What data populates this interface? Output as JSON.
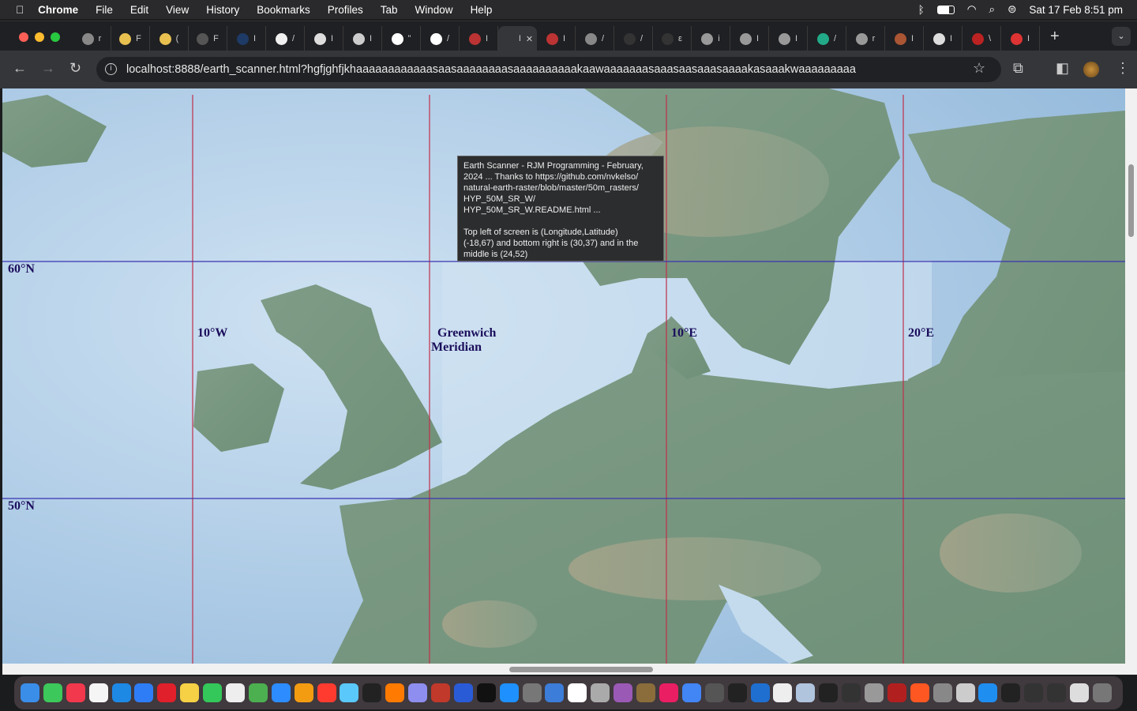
{
  "menubar": {
    "apple": "",
    "app": "Chrome",
    "items": [
      "File",
      "Edit",
      "View",
      "History",
      "Bookmarks",
      "Profiles",
      "Tab",
      "Window",
      "Help"
    ],
    "clock": "Sat 17 Feb  8:51 pm",
    "status_icons": [
      "bluetooth-icon",
      "battery-icon",
      "wifi-icon",
      "search-icon",
      "control-center-icon"
    ]
  },
  "tabs": [
    {
      "t": "r",
      "c": "#888"
    },
    {
      "t": "F",
      "c": "#e8c050"
    },
    {
      "t": "(",
      "c": "#e8c050"
    },
    {
      "t": "F",
      "c": "#555"
    },
    {
      "t": "I",
      "c": "#1e3a66"
    },
    {
      "t": "/",
      "c": "#f0f0f0"
    },
    {
      "t": "I",
      "c": "#ddd"
    },
    {
      "t": "I",
      "c": "#ccc"
    },
    {
      "t": "\"",
      "c": "#fff"
    },
    {
      "t": "/",
      "c": "#fff"
    },
    {
      "t": "I",
      "c": "#b33"
    },
    {
      "t": "I",
      "c": "#35363a",
      "active": true
    },
    {
      "t": "I",
      "c": "#b33"
    },
    {
      "t": "/",
      "c": "#888"
    },
    {
      "t": "/",
      "c": "#333"
    },
    {
      "t": "ε",
      "c": "#333"
    },
    {
      "t": "i",
      "c": "#999"
    },
    {
      "t": "I",
      "c": "#999"
    },
    {
      "t": "I",
      "c": "#999"
    },
    {
      "t": "/",
      "c": "#2a8"
    },
    {
      "t": "r",
      "c": "#999"
    },
    {
      "t": "I",
      "c": "#a53"
    },
    {
      "t": "I",
      "c": "#ddd"
    },
    {
      "t": "\\",
      "c": "#b22"
    },
    {
      "t": "I",
      "c": "#d33"
    }
  ],
  "active_tab_close": "✕",
  "new_tab": "+",
  "url": "localhost:8888/earth_scanner.html?hgfjghfjkhaaaaaaaaaaaasaasaaaaaaaasaaaaaaaaaakaawaaaaaaasaaasaasaaasaaaakasaaakwaaaaaaaaa",
  "map": {
    "latitude_labels": [
      "60°N",
      "50°N"
    ],
    "longitude_labels": [
      "10°W",
      "Greenwich\nMeridian",
      "10°E",
      "20°E"
    ],
    "meridian_color": "#c0304a",
    "parallel_color": "#3a33b0",
    "tooltip": "Earth Scanner - RJM Programming - February, 2024 ... Thanks to https://github.com/nvkelso/\nnatural-earth-raster/blob/master/50m_rasters/\nHYP_50M_SR_W/\nHYP_50M_SR_W.README.html ...\n\nTop left of screen is (Longitude,Latitude)\n(-18,67) and bottom right is (30,37) and in the middle is (24,52)"
  },
  "dock": [
    "finder",
    "messages",
    "music",
    "reminders",
    "safari",
    "mail",
    "opera",
    "notes",
    "facetime",
    "textedit",
    "maps",
    "zoom",
    "photos",
    "news",
    "preview",
    "terminal",
    "firefox",
    "launchpad",
    "filezilla",
    "bbedit",
    "appletv",
    "appstore",
    "calculator",
    "xcode",
    "calendar",
    "system-prefs",
    "podcasts",
    "keychain",
    "intellij",
    "chrome",
    "gimp",
    "terminal2",
    "quicktime",
    "files",
    "spectrum",
    "terminal3",
    "monitor",
    "gpt",
    "firefox-dev",
    "spinner",
    "screenshot",
    "downloads",
    "globe",
    "window1",
    "window2",
    "window3",
    "preview2",
    "trash"
  ]
}
